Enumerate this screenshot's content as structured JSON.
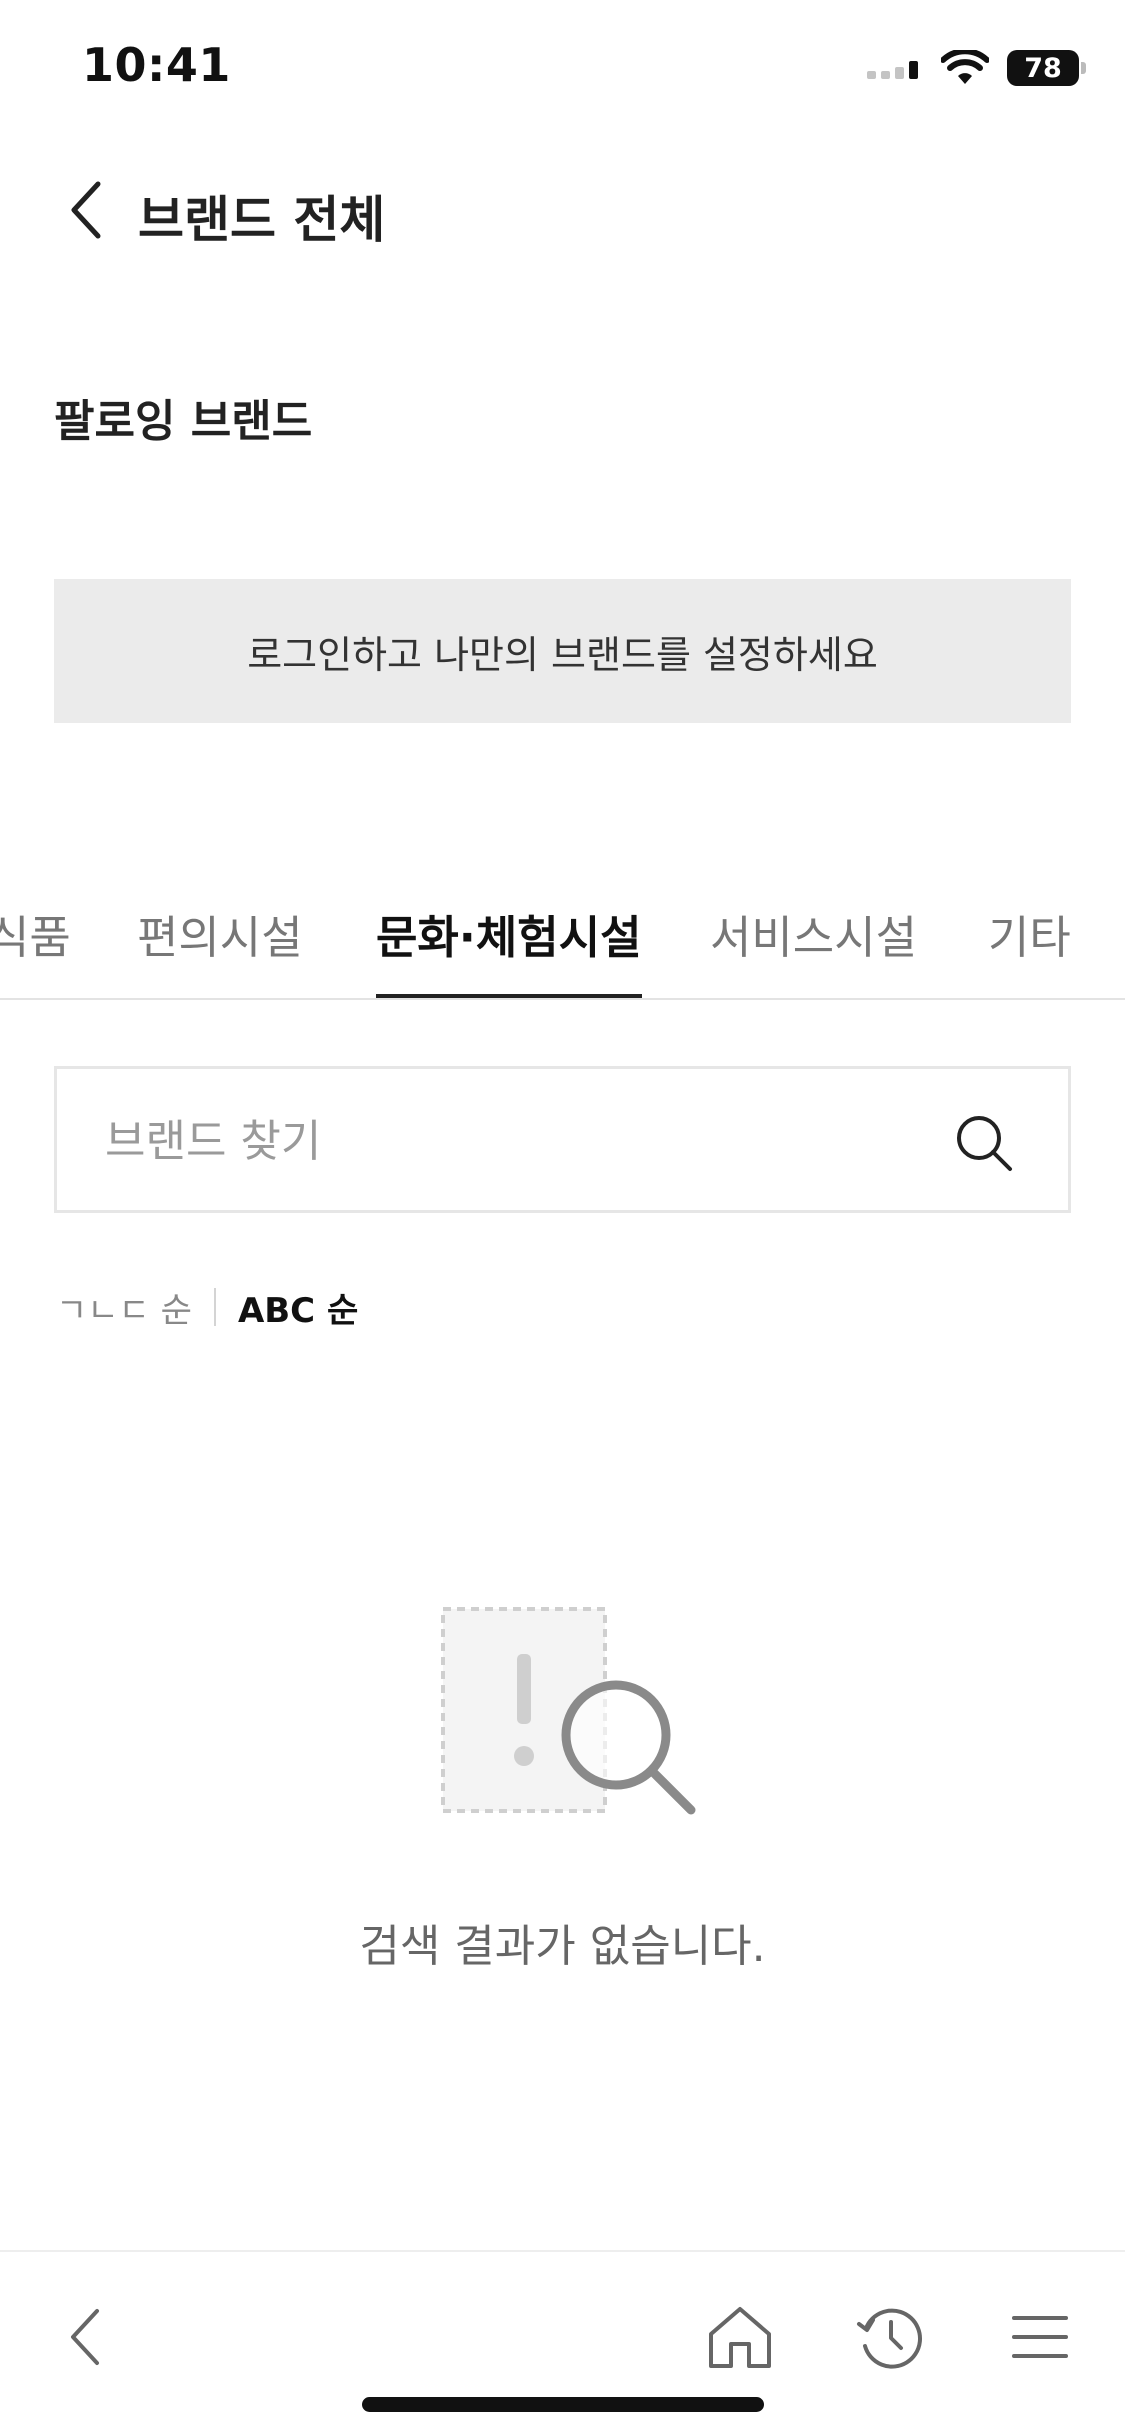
{
  "status_bar": {
    "time": "10:41",
    "battery": "78",
    "icons": [
      "signal-icon",
      "wifi-icon",
      "battery-icon"
    ]
  },
  "header": {
    "back_icon": "chevron-left-icon",
    "title": "브랜드 전체"
  },
  "following": {
    "title": "팔로잉 브랜드",
    "login_prompt": "로그인하고 나만의 브랜드를 설정하세요"
  },
  "tabs": [
    {
      "label": "식품",
      "active": false
    },
    {
      "label": "편의시설",
      "active": false
    },
    {
      "label": "문화·체험시설",
      "active": true
    },
    {
      "label": "서비스시설",
      "active": false
    },
    {
      "label": "기타",
      "active": false
    }
  ],
  "search": {
    "placeholder": "브랜드 찾기",
    "value": "",
    "icon": "search-icon"
  },
  "sort": {
    "options": [
      {
        "label": "ㄱㄴㄷ 순",
        "active": false
      },
      {
        "label": "ABC 순",
        "active": true
      }
    ]
  },
  "empty_state": {
    "icon": "no-results-icon",
    "message": "검색 결과가 없습니다."
  },
  "bottom_nav": {
    "items": [
      "back-icon",
      "home-icon",
      "history-icon",
      "menu-icon"
    ]
  },
  "colors": {
    "text_primary": "#222222",
    "text_muted": "#777777",
    "banner_bg": "#ebebeb",
    "divider": "#e3e3e3"
  }
}
